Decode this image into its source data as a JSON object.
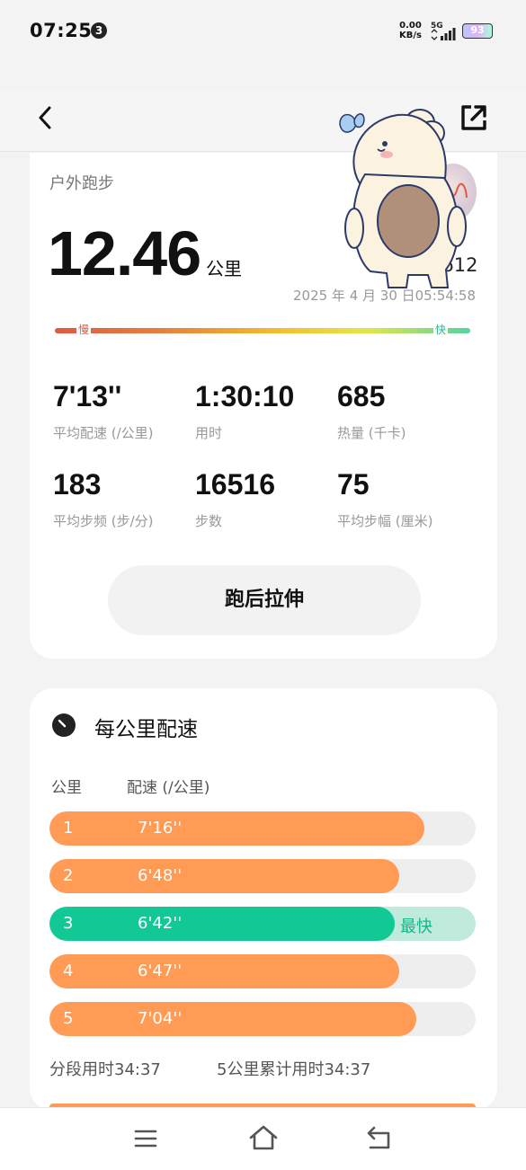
{
  "status_bar": {
    "time": "07:25",
    "notification_count": "3",
    "net_speed_value": "0.00",
    "net_speed_unit": "KB/s",
    "network": "5G",
    "battery": "93"
  },
  "summary": {
    "sport_type": "户外跑步",
    "distance": "12.46",
    "distance_unit": "公里",
    "record_id_partial": "1612",
    "datetime": "2025 年 4 月 30 日05:54:58",
    "pace_slow_label": "慢",
    "pace_fast_label": "快",
    "stats": [
      {
        "value": "7'13''",
        "label": "平均配速 (/公里)"
      },
      {
        "value": "1:30:10",
        "label": "用时"
      },
      {
        "value": "685",
        "label": "热量 (千卡)"
      },
      {
        "value": "183",
        "label": "平均步频 (步/分)"
      },
      {
        "value": "16516",
        "label": "步数"
      },
      {
        "value": "75",
        "label": "平均步幅 (厘米)"
      }
    ],
    "stretch_button": "跑后拉伸"
  },
  "splits": {
    "title": "每公里配速",
    "col_km": "公里",
    "col_pace": "配速 (/公里)",
    "rows": [
      {
        "km": "1",
        "pace": "7'16''",
        "fill": 0.88,
        "tag": ""
      },
      {
        "km": "2",
        "pace": "6'48''",
        "fill": 0.82,
        "tag": ""
      },
      {
        "km": "3",
        "pace": "6'42''",
        "fill": 0.81,
        "tag": "最快"
      },
      {
        "km": "4",
        "pace": "6'47''",
        "fill": 0.82,
        "tag": ""
      },
      {
        "km": "5",
        "pace": "7'04''",
        "fill": 0.86,
        "tag": ""
      }
    ],
    "segment_time": "分段用时34:37",
    "cumulative_time": "5公里累计用时34:37"
  },
  "colors": {
    "split_bar": "#ff9b55",
    "fastest_bar": "#12c995",
    "fastest_track": "#bfeadc"
  }
}
